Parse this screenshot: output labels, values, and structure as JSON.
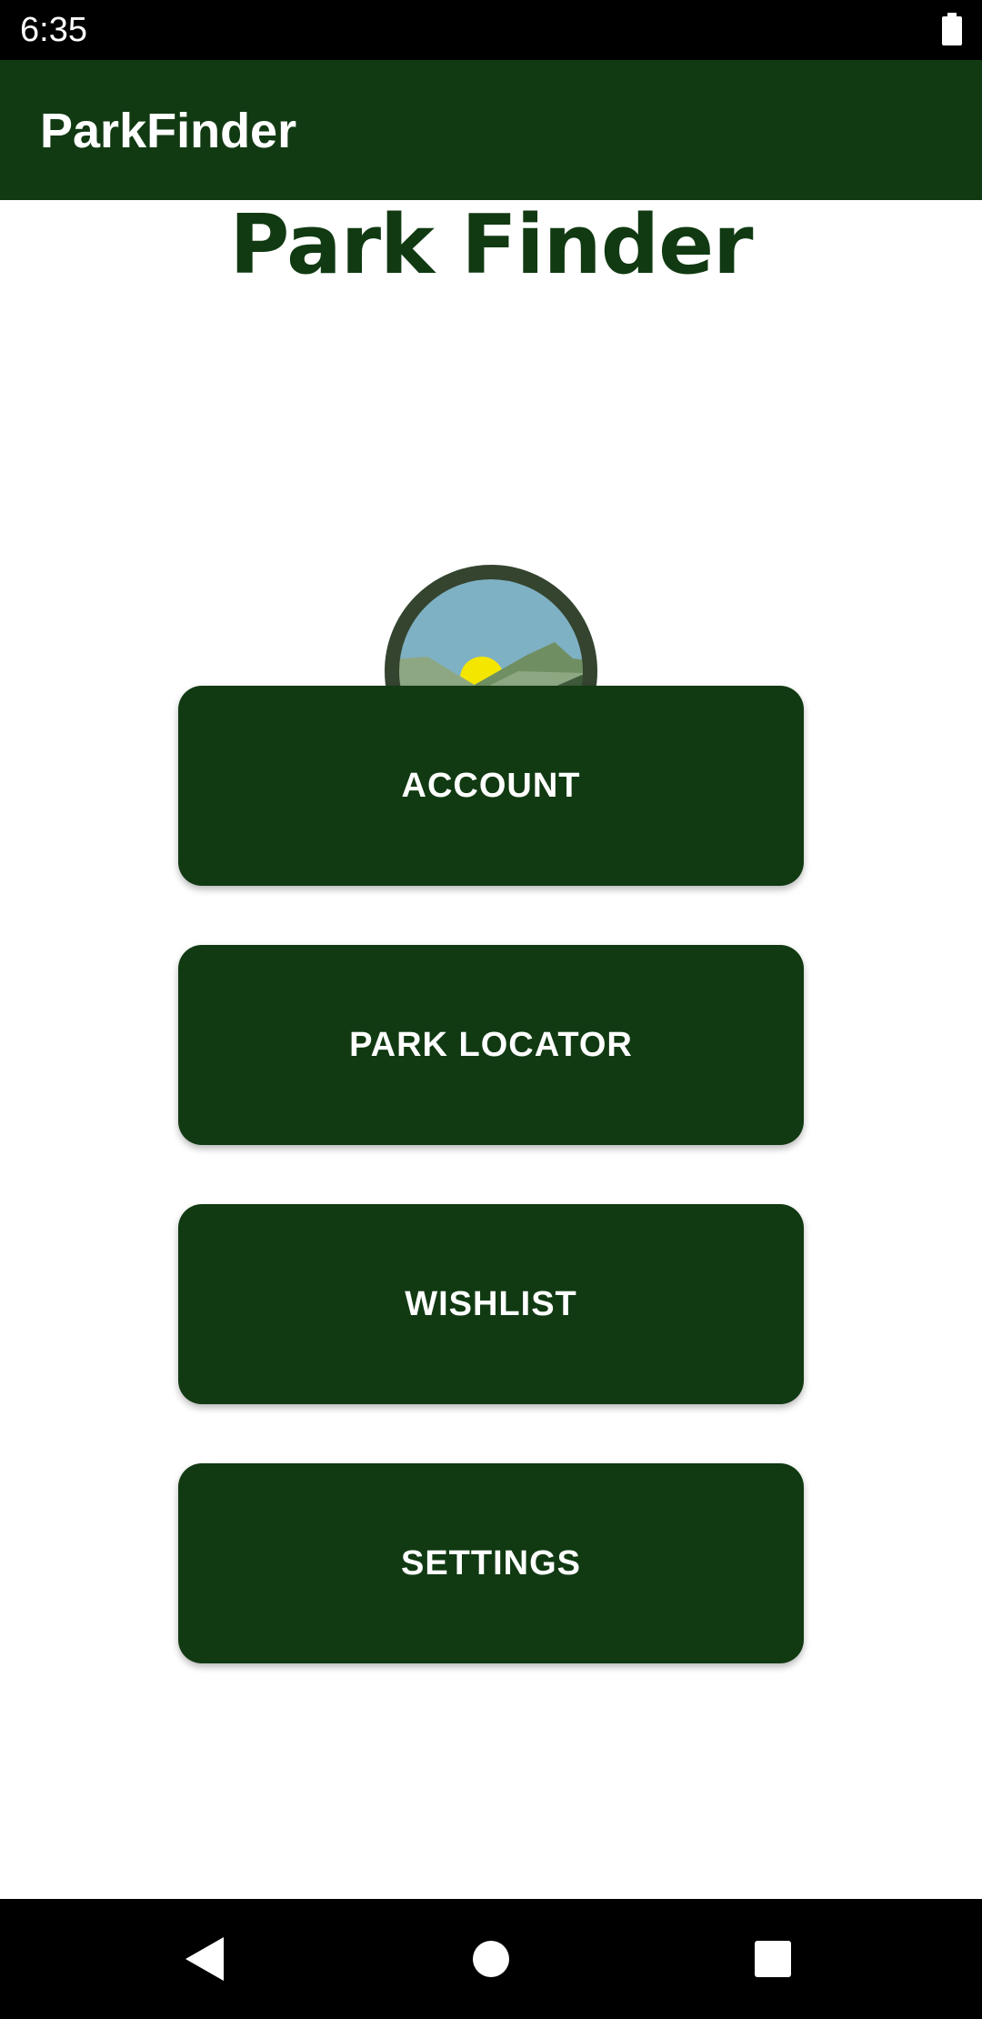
{
  "status_bar": {
    "time": "6:35",
    "battery_icon": "battery-full-icon"
  },
  "app_bar": {
    "title": "ParkFinder"
  },
  "main": {
    "heading": "Park Finder",
    "logo_icon": "park-finder-logo-magnifier-icon",
    "buttons": [
      {
        "label": "ACCOUNT"
      },
      {
        "label": "PARK LOCATOR"
      },
      {
        "label": "WISHLIST"
      },
      {
        "label": "SETTINGS"
      }
    ]
  },
  "nav_bar": {
    "back_icon": "back-triangle-icon",
    "home_icon": "home-circle-icon",
    "recents_icon": "recents-square-icon"
  },
  "colors": {
    "primary": "#113a12",
    "status_bar": "#000000",
    "text_on_primary": "#ffffff",
    "logo_sky": "#7fb1c4",
    "logo_sun": "#f5e600",
    "logo_hill_light": "#8ea783",
    "logo_hill_dark": "#3f5a3b",
    "logo_ring": "#34442f"
  }
}
